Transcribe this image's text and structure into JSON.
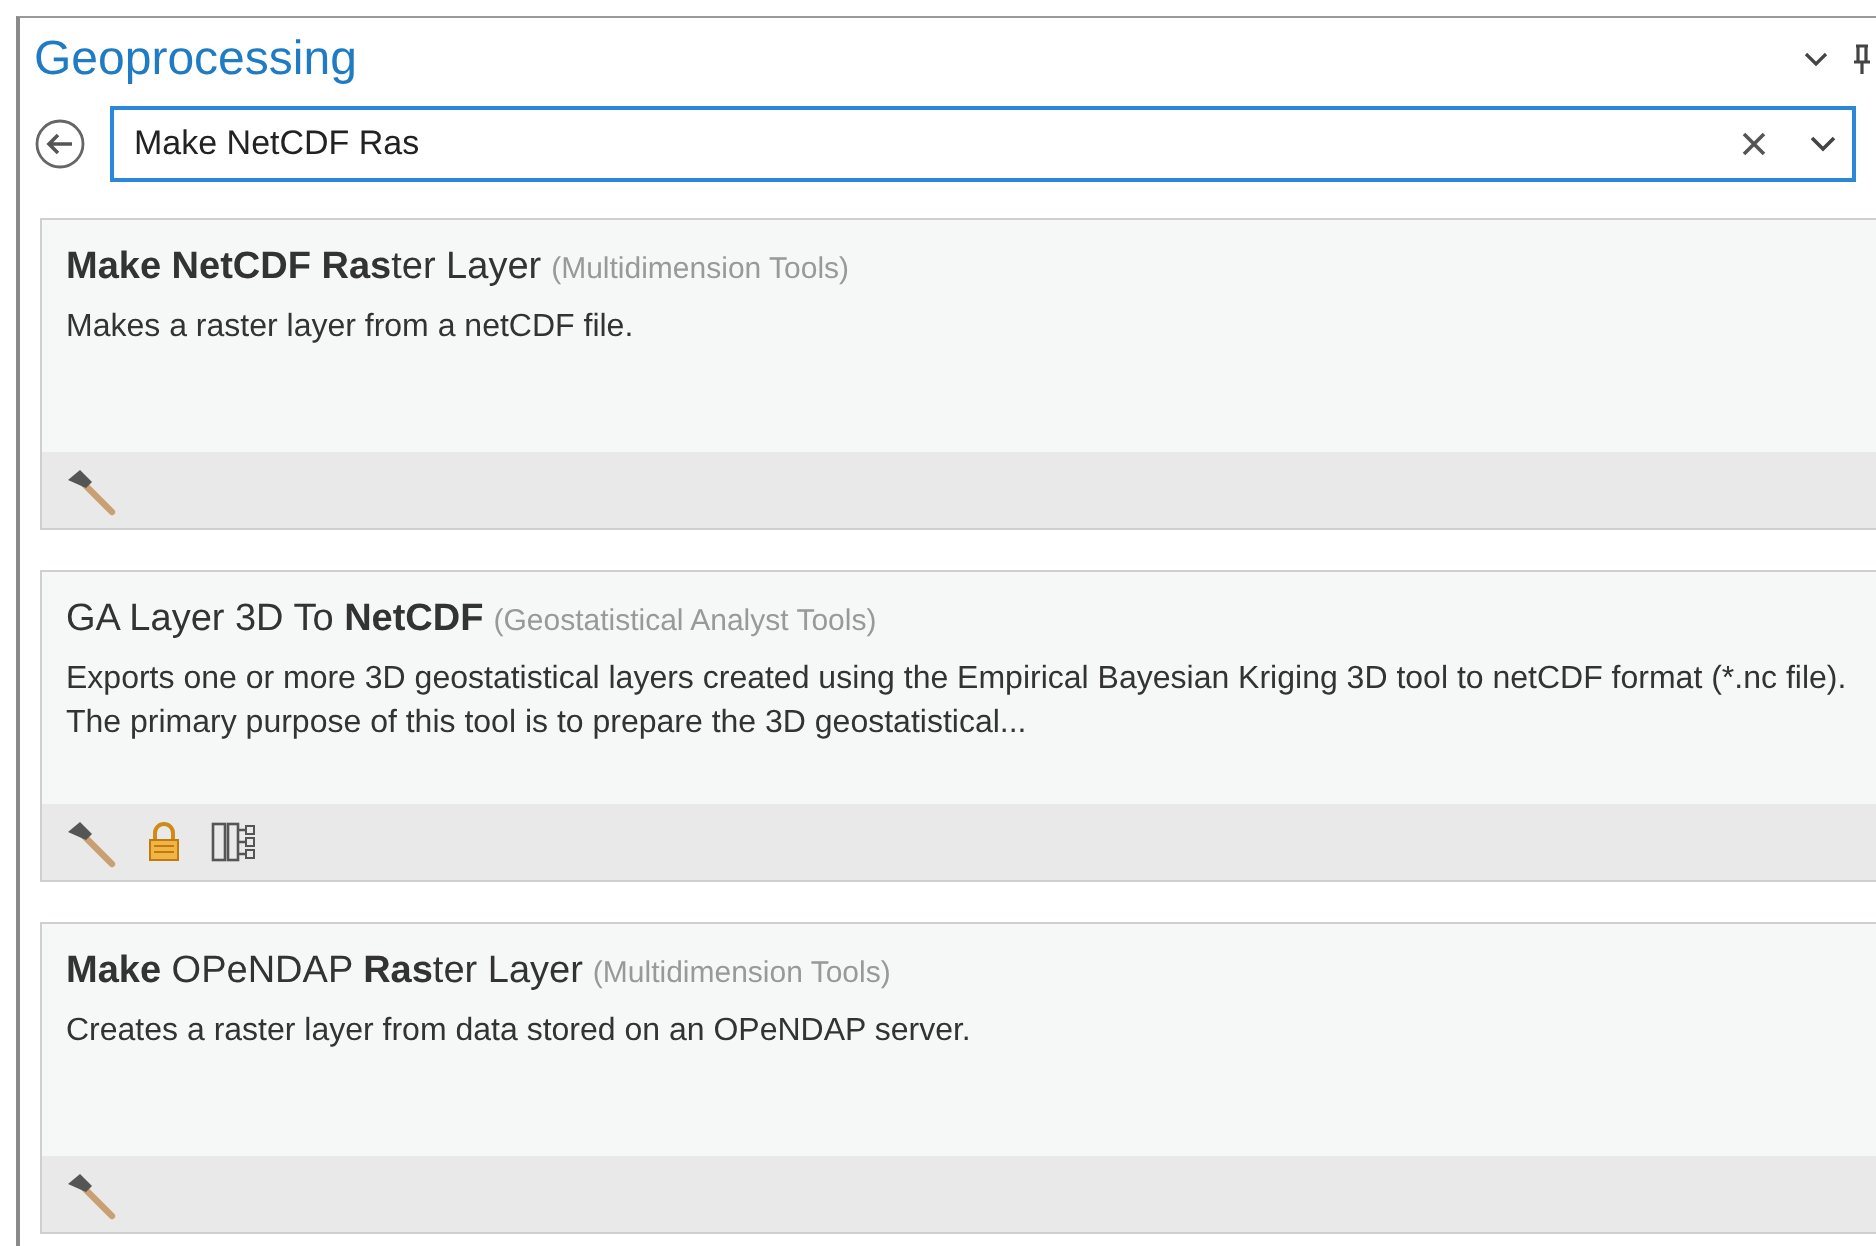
{
  "pane": {
    "title": "Geoprocessing"
  },
  "search": {
    "value": "Make NetCDF Ras"
  },
  "results": [
    {
      "title": "**Make NetCDF Ras**ter Layer",
      "toolbox": "(Multidimension Tools)",
      "description": "Makes a raster layer from a netCDF file.",
      "icons": [
        {
          "kind": "hammer"
        }
      ]
    },
    {
      "title": "GA Layer 3D To **NetCDF**",
      "toolbox": "(Geostatistical Analyst Tools)",
      "description": "Exports one or more 3D geostatistical layers created using the Empirical Bayesian Kriging 3D tool to netCDF format (*.nc file). The primary purpose of this tool is to prepare the 3D geostatistical...",
      "icons": [
        {
          "kind": "hammer"
        },
        {
          "kind": "lock"
        },
        {
          "kind": "model"
        }
      ]
    },
    {
      "title": "**Make** OPeNDAP **Ras**ter Layer",
      "toolbox": "(Multidimension Tools)",
      "description": "Creates a raster layer from data stored on an OPeNDAP server.",
      "icons": [
        {
          "kind": "hammer"
        }
      ]
    }
  ]
}
